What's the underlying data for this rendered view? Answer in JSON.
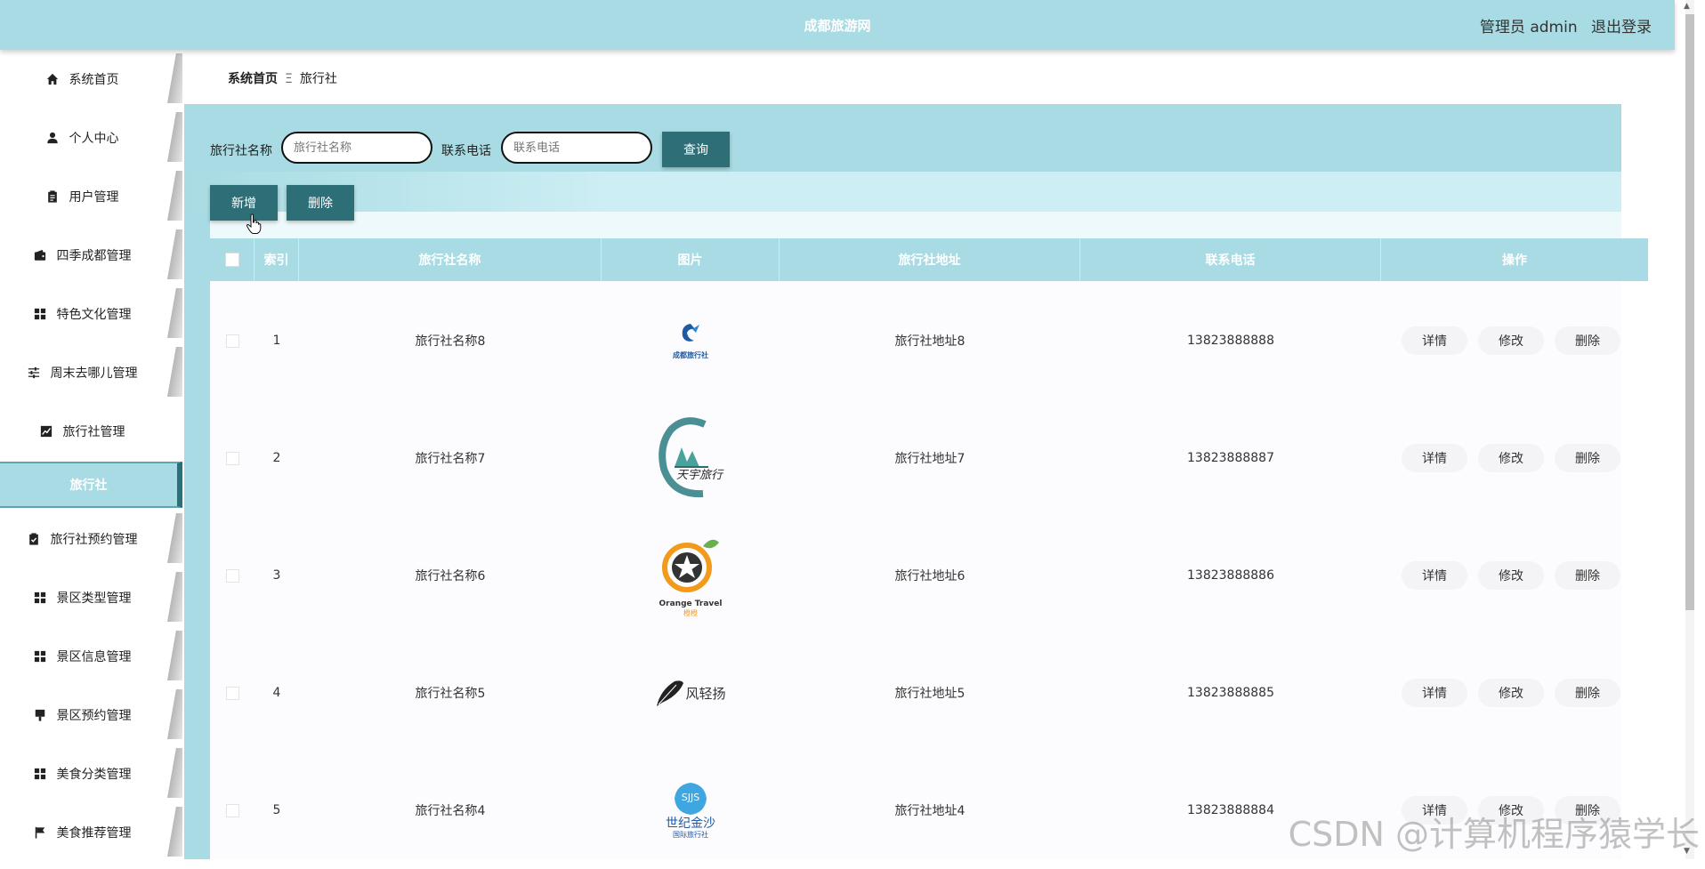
{
  "header": {
    "site_title": "成都旅游网",
    "user_label": "管理员 admin",
    "logout_label": "退出登录"
  },
  "sidebar": {
    "items": [
      {
        "label": "系统首页",
        "icon": "home-icon"
      },
      {
        "label": "个人中心",
        "icon": "person-icon"
      },
      {
        "label": "用户管理",
        "icon": "clipboard-icon"
      },
      {
        "label": "四季成都管理",
        "icon": "wallet-icon"
      },
      {
        "label": "特色文化管理",
        "icon": "grid-icon"
      },
      {
        "label": "周末去哪儿管理",
        "icon": "sliders-icon"
      },
      {
        "label": "旅行社管理",
        "icon": "chart-icon"
      },
      {
        "label": "旅行社预约管理",
        "icon": "clipboard-check-icon"
      },
      {
        "label": "景区类型管理",
        "icon": "grid-icon"
      },
      {
        "label": "景区信息管理",
        "icon": "grid-icon"
      },
      {
        "label": "景区预约管理",
        "icon": "brush-icon"
      },
      {
        "label": "美食分类管理",
        "icon": "grid-icon"
      },
      {
        "label": "美食推荐管理",
        "icon": "flag-icon"
      }
    ],
    "active_sub": "旅行社"
  },
  "breadcrumb": {
    "home": "系统首页",
    "separator": "Ξ",
    "current": "旅行社"
  },
  "search": {
    "name_label": "旅行社名称",
    "name_placeholder": "旅行社名称",
    "phone_label": "联系电话",
    "phone_placeholder": "联系电话",
    "query_button": "查询"
  },
  "actions": {
    "add_button": "新增",
    "delete_button": "删除"
  },
  "table": {
    "columns": [
      "索引",
      "旅行社名称",
      "图片",
      "旅行社地址",
      "联系电话",
      "操作"
    ],
    "rows": [
      {
        "index": "1",
        "name": "旅行社名称8",
        "address": "旅行社地址8",
        "phone": "13823888888",
        "logo": "logo-blue-bird"
      },
      {
        "index": "2",
        "name": "旅行社名称7",
        "address": "旅行社地址7",
        "phone": "13823888887",
        "logo": "logo-tianyu-travel"
      },
      {
        "index": "3",
        "name": "旅行社名称6",
        "address": "旅行社地址6",
        "phone": "13823888886",
        "logo": "logo-orange-travel"
      },
      {
        "index": "4",
        "name": "旅行社名称5",
        "address": "旅行社地址5",
        "phone": "13823888885",
        "logo": "logo-fengqingyang"
      },
      {
        "index": "5",
        "name": "旅行社名称4",
        "address": "旅行社地址4",
        "phone": "13823888884",
        "logo": "logo-sjjs"
      }
    ],
    "op_labels": {
      "detail": "详情",
      "edit": "修改",
      "delete": "删除"
    }
  },
  "logos": {
    "row1_text": "成都旅行社",
    "row2_text": "天宇旅行",
    "row3_text": "Orange Travel",
    "row3_sub": "橙橙",
    "row4_text": "风轻扬",
    "row5_top": "SJJS",
    "row5_text": "世纪金沙",
    "row5_sub": "国际旅行社"
  },
  "watermark": "CSDN @计算机程序猿学长",
  "colors": {
    "header": "#a8dbe3",
    "button": "#2e6f77",
    "active_border": "#2e6f77"
  }
}
